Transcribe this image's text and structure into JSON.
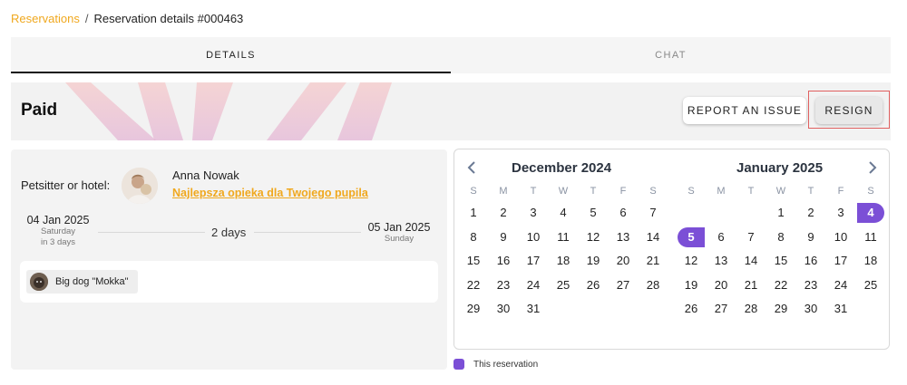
{
  "breadcrumb": {
    "root": "Reservations",
    "separator": "/",
    "current": "Reservation details #000463"
  },
  "tabs": [
    {
      "label": "DETAILS",
      "active": true
    },
    {
      "label": "CHAT",
      "active": false
    }
  ],
  "status": {
    "title": "Paid",
    "report_label": "REPORT AN ISSUE",
    "resign_label": "RESIGN"
  },
  "sitter": {
    "label": "Petsitter or hotel:",
    "name": "Anna Nowak",
    "link_text": "Najlepsza opieka dla Twojego pupila"
  },
  "dates": {
    "start": "04 Jan 2025",
    "start_weekday": "Saturday",
    "start_relative": "in 3 days",
    "duration": "2 days",
    "end": "05 Jan 2025",
    "end_weekday": "Sunday"
  },
  "pets": [
    {
      "name": "Big dog \"Mokka\""
    }
  ],
  "calendar": {
    "weekdays": [
      "S",
      "M",
      "T",
      "W",
      "T",
      "F",
      "S"
    ],
    "months": [
      {
        "title": "December 2024",
        "weeks": [
          [
            "1",
            "2",
            "3",
            "4",
            "5",
            "6",
            "7"
          ],
          [
            "8",
            "9",
            "10",
            "11",
            "12",
            "13",
            "14"
          ],
          [
            "15",
            "16",
            "17",
            "18",
            "19",
            "20",
            "21"
          ],
          [
            "22",
            "23",
            "24",
            "25",
            "26",
            "27",
            "28"
          ],
          [
            "29",
            "30",
            "31",
            "",
            "",
            "",
            ""
          ]
        ]
      },
      {
        "title": "January 2025",
        "weeks": [
          [
            "",
            "",
            "",
            "1",
            "2",
            "3",
            "4"
          ],
          [
            "5",
            "6",
            "7",
            "8",
            "9",
            "10",
            "11"
          ],
          [
            "12",
            "13",
            "14",
            "15",
            "16",
            "17",
            "18"
          ],
          [
            "19",
            "20",
            "21",
            "22",
            "23",
            "24",
            "25"
          ],
          [
            "26",
            "27",
            "28",
            "29",
            "30",
            "31",
            ""
          ]
        ],
        "selected": [
          "4",
          "5"
        ]
      }
    ]
  },
  "legend": {
    "label": "This reservation"
  },
  "colors": {
    "accent": "#f0a81e",
    "selection": "#7b4fd6",
    "highlight_frame": "#e06060"
  },
  "icons": {
    "prev": "chevron-left-icon",
    "next": "chevron-right-icon"
  }
}
